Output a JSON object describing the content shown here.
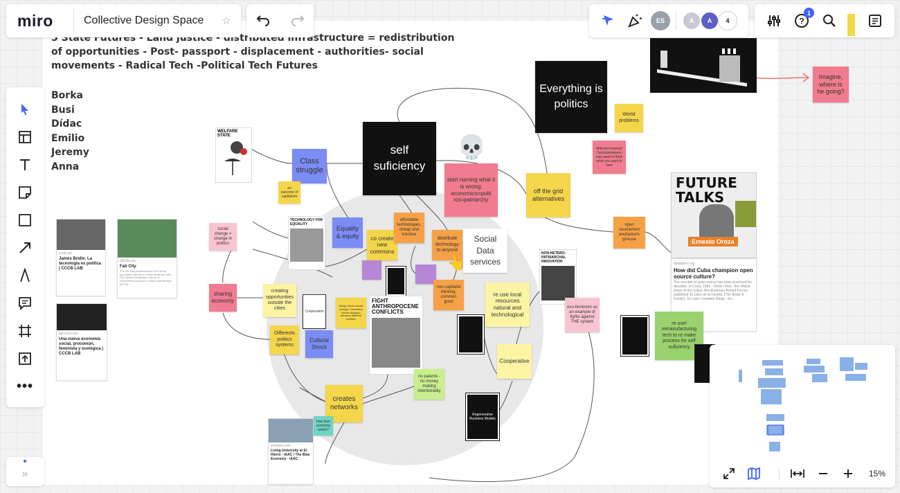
{
  "app": {
    "logo": "miro",
    "board_title": "Collective Design Space"
  },
  "toolbar": {
    "undo_icon": "undo-icon",
    "redo_icon": "redo-icon",
    "collab_count": "4",
    "notif_count": "1",
    "avatar_es": "ES",
    "avatar_a1": "A",
    "avatar_a2": "A",
    "zoom": "15%"
  },
  "board": {
    "header": "5 State Futures - Land justice - distributed infrastructure = redistribution of opportunities - Post- passport - displacement - authorities- social movements - Radical Tech -Political Tech Futures",
    "names": [
      "Borka",
      "Busi",
      "Dídac",
      "Emilio",
      "Jeremy",
      "Anna"
    ]
  },
  "notes": {
    "self_suficiency": "self suficiency",
    "everything_politics": "Everything is politics",
    "class_struggle": "Class struggle",
    "start_naming": "start naming what it is wrong: economics=polit ics=patriarchy",
    "world_problems": "World problems",
    "without_knowing": "Without knowing! Decisionmakers only want to think what you want to hear",
    "imagine": "Imagine, where is he going?",
    "off_grid": "off the grid alternatives",
    "outcome": "an outcome of capitalism",
    "social_change": "social change = change in politics",
    "equality": "Equality & equity",
    "co_create": "co create new commons",
    "affordable_tech": "affordable technologies, cheap and intuitive",
    "distribute_tech": "distribute technology to anyone",
    "social_data": "Social Data services",
    "open_source": "open source/rem anufacturin g/reuse",
    "sharing_economy": "sharing economy",
    "creating_opps": "creating opportunities outside the cities",
    "non_capitalist": "non-capitalist thinking, common good",
    "reuse_local": "re use local resources natural and technological",
    "eco_feminism": "eco-feminism as an example of fights against THE system",
    "reuse_remanufacturing": "re use/ remanufacturing tech to re make process for self suficiency",
    "different_politics": "Differents politics systems",
    "cultural_shock": "Cultural Shock",
    "things_driven": "things driven social change, innovation driven dialogue between different realities",
    "cooperative": "Cooperative",
    "no_patents": "no patents - no money making intentionality",
    "creates_networks": "creates networks",
    "how_blue": "how blue economy works?",
    "cooperation": "Cooperation"
  },
  "posters": {
    "welfare": "WELFARE STATE",
    "tech_equality": "TECHNOLOGY FOR EQUALITY",
    "fight": "FIGHT ANTHROPOCENE CONFLICTS",
    "non_hetero": "NON-HETERO-PATRIARCHAL INNOVATION",
    "future_talks": "FUTURE TALKS",
    "future_talks_name": "Ernesto Oroza",
    "regenerative": "Regenerative Business Models"
  },
  "cards": {
    "james_src": "ccub.cat",
    "james_title": "James Bridle: La tecnología es política | CCCB LAB",
    "fabcity_src": "fabcity.org",
    "fabcity_title": "Fab City",
    "fabcity_desc": "The UN has predicted that 70% of the population will live in urban areas by 2050. Our current ecosystem rely on a consumerist product to model and lifestyle (PITO) ...",
    "economia_src": "lab.cccb.org",
    "economia_title": "Una nueva economía social, procomún, feminista y ecológica | CCCB LAB",
    "living_src": "youtube.com",
    "living_title": "Living University at El Hierro - IAAC / The Blue Economy - IAAC",
    "cuba_src": "fablabbcn.org",
    "cuba_title": "How did Cuba champion open source culture?",
    "cuba_desc": "The concept of open source has been practiced for decades. In Cuba, 1991 - Verde Olivo - the official press of the Cuban Revolutionary Armed Forces published 'El Libro de la Familia' (The Book of Family). 'El Libro' complies things - fro..."
  },
  "colors": {
    "accent": "#4262ff",
    "frame": "#ffffff",
    "canvas": "#f2f2f2"
  }
}
